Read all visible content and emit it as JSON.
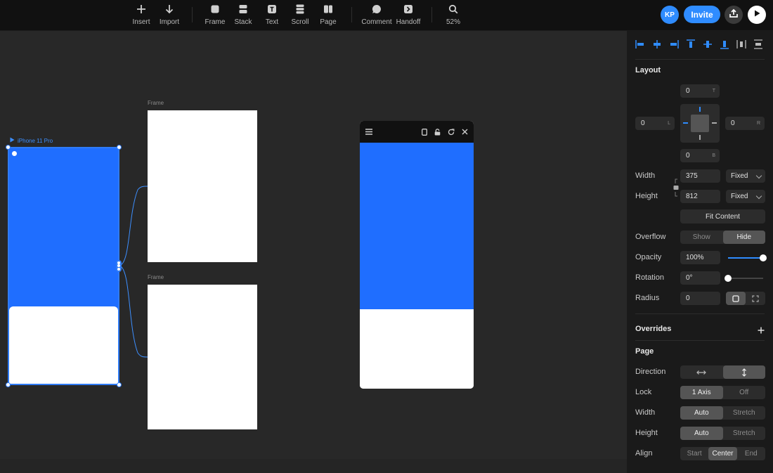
{
  "toolbar": {
    "insert": "Insert",
    "import": "Import",
    "frame": "Frame",
    "stack": "Stack",
    "text": "Text",
    "scroll": "Scroll",
    "page": "Page",
    "comment": "Comment",
    "handoff": "Handoff",
    "zoom": "52%",
    "avatar_initials": "KP",
    "invite": "Invite"
  },
  "canvas": {
    "frame_label_1": "Frame",
    "frame_label_2": "Frame",
    "iphone_label": "iPhone 11 Pro"
  },
  "panel": {
    "layout_title": "Layout",
    "pad_top": "0",
    "pad_top_suffix": "T",
    "pad_left": "0",
    "pad_left_suffix": "L",
    "pad_right": "0",
    "pad_right_suffix": "R",
    "pad_bottom": "0",
    "pad_bottom_suffix": "B",
    "width_label": "Width",
    "width_value": "375",
    "width_mode": "Fixed",
    "height_label": "Height",
    "height_value": "812",
    "height_mode": "Fixed",
    "fit_content": "Fit Content",
    "overflow_label": "Overflow",
    "overflow_show": "Show",
    "overflow_hide": "Hide",
    "opacity_label": "Opacity",
    "opacity_value": "100%",
    "opacity_level": 1.0,
    "rotation_label": "Rotation",
    "rotation_value": "0°",
    "rotation_level": 0.0,
    "radius_label": "Radius",
    "radius_value": "0",
    "overrides_title": "Overrides",
    "page_title": "Page",
    "direction_label": "Direction",
    "lock_label": "Lock",
    "lock_on": "1 Axis",
    "lock_off": "Off",
    "page_width_label": "Width",
    "page_width_auto": "Auto",
    "page_width_stretch": "Stretch",
    "page_height_label": "Height",
    "page_height_auto": "Auto",
    "page_height_stretch": "Stretch",
    "align_label": "Align",
    "align_start": "Start",
    "align_center": "Center",
    "align_end": "End"
  },
  "colors": {
    "accent": "#2f8cff",
    "frame_blue": "#1f6eff"
  }
}
